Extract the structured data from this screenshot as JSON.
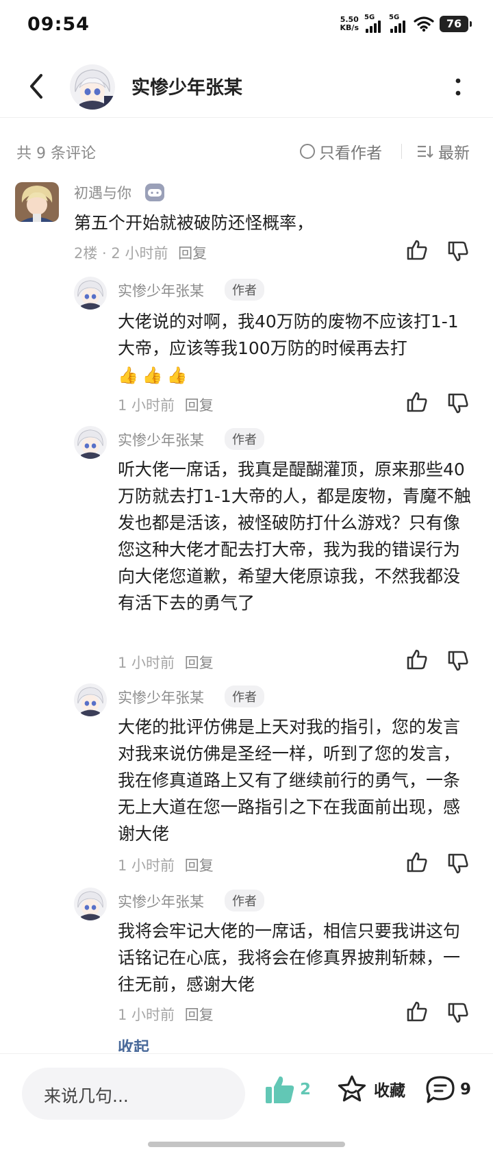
{
  "status_bar": {
    "time": "09:54",
    "speed_value": "5.50",
    "speed_unit": "KB/s",
    "net1": "5G",
    "net2": "5G",
    "battery": "76"
  },
  "header": {
    "title": "实惨少年张某",
    "back_icon": "chevron-left-icon",
    "more_icon": "more-vertical-icon"
  },
  "filter": {
    "count": "共 9 条评论",
    "only_author": "只看作者",
    "sort": "最新"
  },
  "comments": [
    {
      "user": "初遇与你",
      "text": "第五个开始就被破防还怪概率，",
      "floor": "2楼",
      "time": "2 小时前",
      "reply": "回复"
    }
  ],
  "replies": [
    {
      "user": "实惨少年张某",
      "badge": "作者",
      "text": "大佬说的对啊，我40万防的废物不应该打1-1大帝，应该等我100万防的时候再去打",
      "emoji": "👍👍👍",
      "time": "1 小时前",
      "reply": "回复"
    },
    {
      "user": "实惨少年张某",
      "badge": "作者",
      "text": "听大佬一席话，我真是醍醐灌顶，原来那些40万防就去打1-1大帝的人，都是废物，青魔不触发也都是活该，被怪破防打什么游戏？只有像您这种大佬才配去打大帝，我为我的错误行为向大佬您道歉，希望大佬原谅我，不然我都没有活下去的勇气了",
      "time": "1 小时前",
      "reply": "回复"
    },
    {
      "user": "实惨少年张某",
      "badge": "作者",
      "text": "大佬的批评仿佛是上天对我的指引，您的发言对我来说仿佛是圣经一样，听到了您的发言，我在修真道路上又有了继续前行的勇气，一条无上大道在您一路指引之下在我面前出现，感谢大佬",
      "time": "1 小时前",
      "reply": "回复"
    },
    {
      "user": "实惨少年张某",
      "badge": "作者",
      "text": "我将会牢记大佬的一席话，相信只要我讲这句话铭记在心底，我将会在修真界披荆斩棘，一往无前，感谢大佬",
      "time": "1 小时前",
      "reply": "回复"
    }
  ],
  "collapse": "收起",
  "bottom": {
    "input_placeholder": "来说几句...",
    "like_count": "2",
    "favorite": "收藏",
    "comment_count": "9"
  },
  "colors": {
    "accent_green": "#62c7b5",
    "link_blue": "#4a6a9a"
  }
}
